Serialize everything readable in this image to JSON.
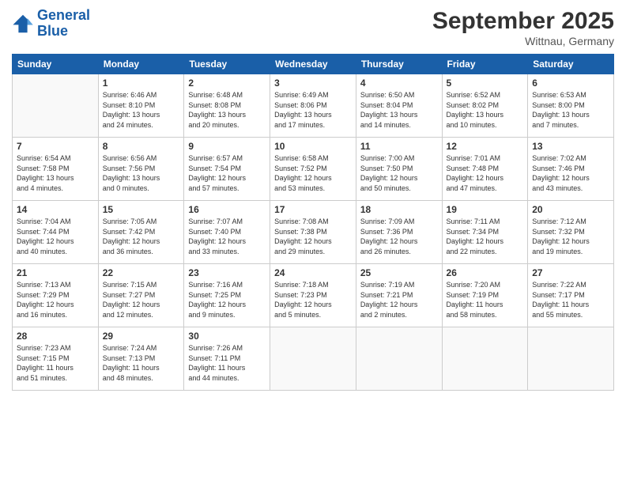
{
  "header": {
    "logo": {
      "line1": "General",
      "line2": "Blue"
    },
    "title": "September 2025",
    "location": "Wittnau, Germany"
  },
  "weekdays": [
    "Sunday",
    "Monday",
    "Tuesday",
    "Wednesday",
    "Thursday",
    "Friday",
    "Saturday"
  ],
  "weeks": [
    [
      {
        "day": "",
        "info": ""
      },
      {
        "day": "1",
        "info": "Sunrise: 6:46 AM\nSunset: 8:10 PM\nDaylight: 13 hours\nand 24 minutes."
      },
      {
        "day": "2",
        "info": "Sunrise: 6:48 AM\nSunset: 8:08 PM\nDaylight: 13 hours\nand 20 minutes."
      },
      {
        "day": "3",
        "info": "Sunrise: 6:49 AM\nSunset: 8:06 PM\nDaylight: 13 hours\nand 17 minutes."
      },
      {
        "day": "4",
        "info": "Sunrise: 6:50 AM\nSunset: 8:04 PM\nDaylight: 13 hours\nand 14 minutes."
      },
      {
        "day": "5",
        "info": "Sunrise: 6:52 AM\nSunset: 8:02 PM\nDaylight: 13 hours\nand 10 minutes."
      },
      {
        "day": "6",
        "info": "Sunrise: 6:53 AM\nSunset: 8:00 PM\nDaylight: 13 hours\nand 7 minutes."
      }
    ],
    [
      {
        "day": "7",
        "info": "Sunrise: 6:54 AM\nSunset: 7:58 PM\nDaylight: 13 hours\nand 4 minutes."
      },
      {
        "day": "8",
        "info": "Sunrise: 6:56 AM\nSunset: 7:56 PM\nDaylight: 13 hours\nand 0 minutes."
      },
      {
        "day": "9",
        "info": "Sunrise: 6:57 AM\nSunset: 7:54 PM\nDaylight: 12 hours\nand 57 minutes."
      },
      {
        "day": "10",
        "info": "Sunrise: 6:58 AM\nSunset: 7:52 PM\nDaylight: 12 hours\nand 53 minutes."
      },
      {
        "day": "11",
        "info": "Sunrise: 7:00 AM\nSunset: 7:50 PM\nDaylight: 12 hours\nand 50 minutes."
      },
      {
        "day": "12",
        "info": "Sunrise: 7:01 AM\nSunset: 7:48 PM\nDaylight: 12 hours\nand 47 minutes."
      },
      {
        "day": "13",
        "info": "Sunrise: 7:02 AM\nSunset: 7:46 PM\nDaylight: 12 hours\nand 43 minutes."
      }
    ],
    [
      {
        "day": "14",
        "info": "Sunrise: 7:04 AM\nSunset: 7:44 PM\nDaylight: 12 hours\nand 40 minutes."
      },
      {
        "day": "15",
        "info": "Sunrise: 7:05 AM\nSunset: 7:42 PM\nDaylight: 12 hours\nand 36 minutes."
      },
      {
        "day": "16",
        "info": "Sunrise: 7:07 AM\nSunset: 7:40 PM\nDaylight: 12 hours\nand 33 minutes."
      },
      {
        "day": "17",
        "info": "Sunrise: 7:08 AM\nSunset: 7:38 PM\nDaylight: 12 hours\nand 29 minutes."
      },
      {
        "day": "18",
        "info": "Sunrise: 7:09 AM\nSunset: 7:36 PM\nDaylight: 12 hours\nand 26 minutes."
      },
      {
        "day": "19",
        "info": "Sunrise: 7:11 AM\nSunset: 7:34 PM\nDaylight: 12 hours\nand 22 minutes."
      },
      {
        "day": "20",
        "info": "Sunrise: 7:12 AM\nSunset: 7:32 PM\nDaylight: 12 hours\nand 19 minutes."
      }
    ],
    [
      {
        "day": "21",
        "info": "Sunrise: 7:13 AM\nSunset: 7:29 PM\nDaylight: 12 hours\nand 16 minutes."
      },
      {
        "day": "22",
        "info": "Sunrise: 7:15 AM\nSunset: 7:27 PM\nDaylight: 12 hours\nand 12 minutes."
      },
      {
        "day": "23",
        "info": "Sunrise: 7:16 AM\nSunset: 7:25 PM\nDaylight: 12 hours\nand 9 minutes."
      },
      {
        "day": "24",
        "info": "Sunrise: 7:18 AM\nSunset: 7:23 PM\nDaylight: 12 hours\nand 5 minutes."
      },
      {
        "day": "25",
        "info": "Sunrise: 7:19 AM\nSunset: 7:21 PM\nDaylight: 12 hours\nand 2 minutes."
      },
      {
        "day": "26",
        "info": "Sunrise: 7:20 AM\nSunset: 7:19 PM\nDaylight: 11 hours\nand 58 minutes."
      },
      {
        "day": "27",
        "info": "Sunrise: 7:22 AM\nSunset: 7:17 PM\nDaylight: 11 hours\nand 55 minutes."
      }
    ],
    [
      {
        "day": "28",
        "info": "Sunrise: 7:23 AM\nSunset: 7:15 PM\nDaylight: 11 hours\nand 51 minutes."
      },
      {
        "day": "29",
        "info": "Sunrise: 7:24 AM\nSunset: 7:13 PM\nDaylight: 11 hours\nand 48 minutes."
      },
      {
        "day": "30",
        "info": "Sunrise: 7:26 AM\nSunset: 7:11 PM\nDaylight: 11 hours\nand 44 minutes."
      },
      {
        "day": "",
        "info": ""
      },
      {
        "day": "",
        "info": ""
      },
      {
        "day": "",
        "info": ""
      },
      {
        "day": "",
        "info": ""
      }
    ]
  ]
}
